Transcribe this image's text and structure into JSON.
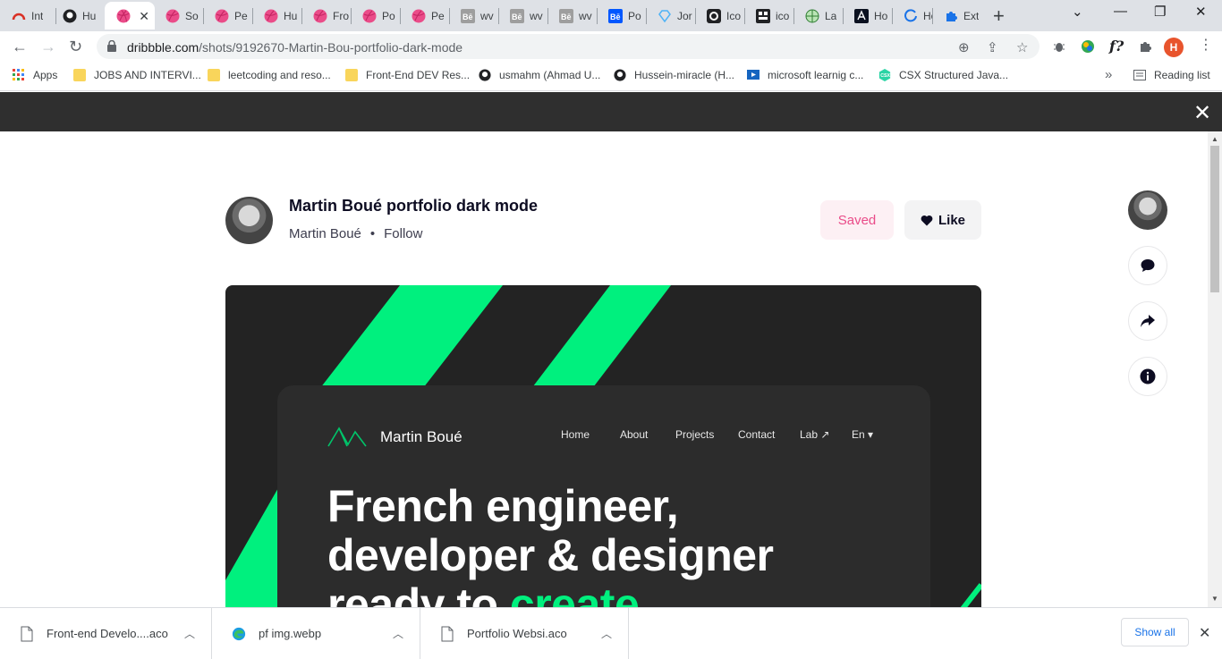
{
  "browser": {
    "tabs": [
      {
        "title": "Int",
        "icon": "gauge-icon"
      },
      {
        "title": "Hu",
        "icon": "github-icon"
      },
      {
        "title": "",
        "icon": "dribbble-icon",
        "active": true
      },
      {
        "title": "So",
        "icon": "dribbble-icon"
      },
      {
        "title": "Pe",
        "icon": "dribbble-icon"
      },
      {
        "title": "Hu",
        "icon": "dribbble-icon"
      },
      {
        "title": "Fro",
        "icon": "dribbble-icon"
      },
      {
        "title": "Po",
        "icon": "dribbble-icon"
      },
      {
        "title": "Pe",
        "icon": "dribbble-icon"
      },
      {
        "title": "wv",
        "icon": "behance-gray-icon"
      },
      {
        "title": "wv",
        "icon": "behance-gray-icon"
      },
      {
        "title": "wv",
        "icon": "behance-gray-icon"
      },
      {
        "title": "Po",
        "icon": "behance-icon"
      },
      {
        "title": "Jor",
        "icon": "diamond-icon"
      },
      {
        "title": "Ico",
        "icon": "icon-o-icon"
      },
      {
        "title": "ico",
        "icon": "icon-grid-icon"
      },
      {
        "title": "La",
        "icon": "globe-green-icon"
      },
      {
        "title": "Ho",
        "icon": "angular-icon"
      },
      {
        "title": "Ho",
        "icon": "loading-icon"
      },
      {
        "title": "Ext",
        "icon": "puzzle-icon"
      }
    ],
    "url_domain": "dribbble.com",
    "url_path": "/shots/9192670-Martin-Bou-portfolio-dark-mode",
    "profile_initial": "H",
    "bookmarks": [
      {
        "label": "Apps",
        "icon": "apps-grid-icon"
      },
      {
        "label": "JOBS AND INTERVI...",
        "icon": "folder-icon"
      },
      {
        "label": "leetcoding and reso...",
        "icon": "folder-icon"
      },
      {
        "label": "Front-End DEV Res...",
        "icon": "folder-icon"
      },
      {
        "label": "usmahm (Ahmad U...",
        "icon": "github-icon"
      },
      {
        "label": "Hussein-miracle (H...",
        "icon": "github-icon"
      },
      {
        "label": "microsoft learnig c...",
        "icon": "play-icon"
      },
      {
        "label": "CSX Structured Java...",
        "icon": "csx-icon"
      }
    ],
    "reading_list": "Reading list",
    "more_bookmarks": "»"
  },
  "shot": {
    "title": "Martin Boué portfolio dark mode",
    "author": "Martin Boué",
    "follow": "Follow",
    "saved_label": "Saved",
    "like_label": "Like",
    "preview": {
      "brand": "Martin Boué",
      "nav": [
        "Home",
        "About",
        "Projects",
        "Contact",
        "Lab ↗",
        "En ▾"
      ],
      "hero_line1": "French engineer,",
      "hero_line2": "developer & designer",
      "hero_line3a": "ready to ",
      "hero_line3b": "create",
      "accent_color": "#00f07e"
    }
  },
  "downloads": {
    "items": [
      {
        "name": "Front-end Develo....aco",
        "icon": "file-icon"
      },
      {
        "name": "pf img.webp",
        "icon": "edge-icon"
      },
      {
        "name": "Portfolio Websi.aco",
        "icon": "file-icon"
      }
    ],
    "show_all": "Show all"
  }
}
